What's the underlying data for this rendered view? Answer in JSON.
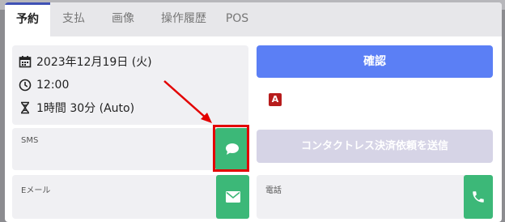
{
  "tabs": [
    {
      "label": "予約",
      "active": true
    },
    {
      "label": "支払",
      "active": false
    },
    {
      "label": "画像",
      "active": false
    },
    {
      "label": "操作履歴",
      "active": false
    },
    {
      "label": "POS",
      "active": false
    }
  ],
  "reservation": {
    "date": "2023年12月19日 (火)",
    "time": "12:00",
    "duration": "1時間 30分 (Auto)"
  },
  "confirm_label": "確認",
  "badge_letter": "A",
  "sms": {
    "label": "SMS"
  },
  "contactless_label": "コンタクトレス決済依頼を送信",
  "email": {
    "label": "Eメール"
  },
  "phone": {
    "label": "電話"
  },
  "colors": {
    "accent_blue": "#5b7ff5",
    "action_green": "#3cb878",
    "highlight_red": "#e30000",
    "tab_active_border": "#3f51b5",
    "disabled_button": "#d6d4e6"
  },
  "icons": [
    "calendar-icon",
    "clock-icon",
    "hourglass-icon",
    "chat-bubble-icon",
    "mail-icon",
    "phone-icon"
  ]
}
